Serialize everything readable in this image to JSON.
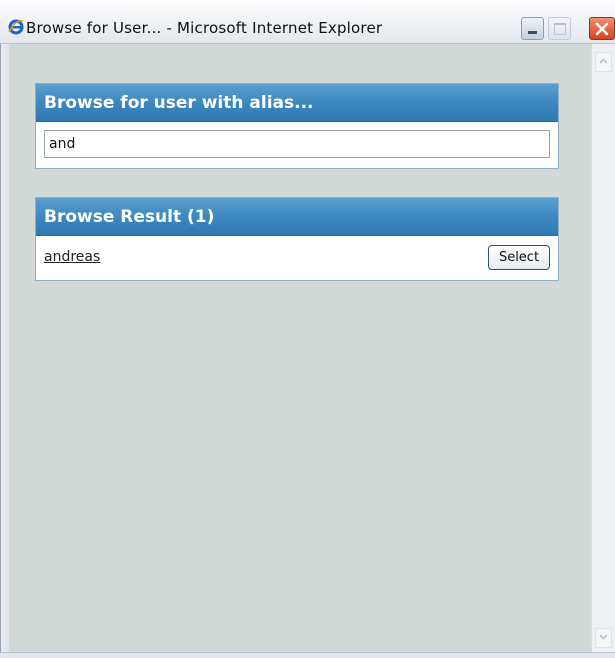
{
  "window": {
    "title": "Browse for User... - Microsoft Internet Explorer",
    "app_icon": "ie-icon",
    "controls": {
      "minimize": "minimize-icon",
      "maximize": "maximize-icon",
      "close": "close-icon"
    }
  },
  "search_panel": {
    "header": "Browse for user with alias...",
    "input_value": "and"
  },
  "result_panel": {
    "header": "Browse Result (1)",
    "results": [
      {
        "alias": "andreas",
        "action_label": "Select"
      }
    ]
  },
  "colors": {
    "panel_header": "#3d88c0",
    "client_background": "#d3d9d6",
    "close_button": "#d6421d"
  }
}
